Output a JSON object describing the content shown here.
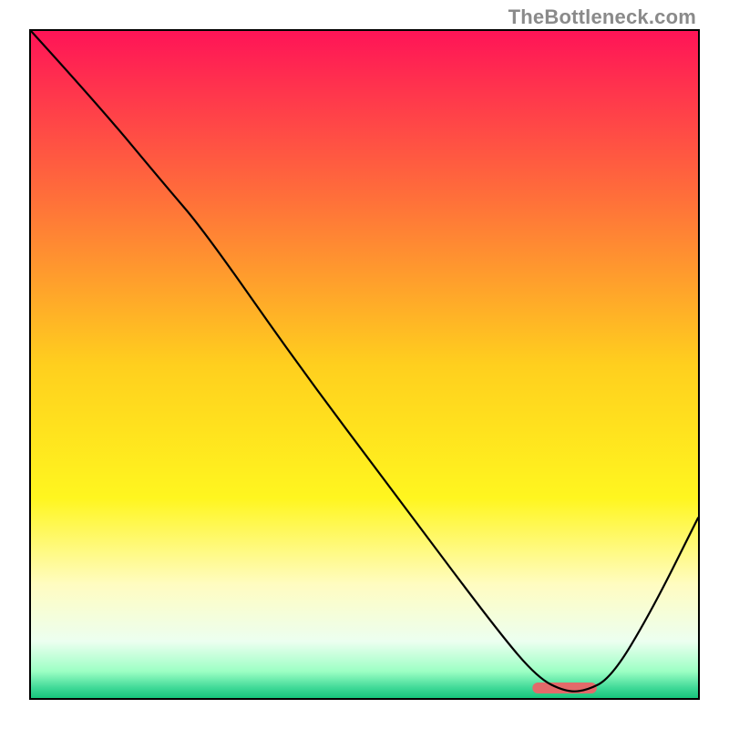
{
  "watermark_text": "TheBottleneck.com",
  "chart_data": {
    "type": "line",
    "title": "",
    "xlabel": "",
    "ylabel": "",
    "xlim": [
      0,
      100
    ],
    "ylim": [
      0,
      100
    ],
    "grid": false,
    "legend": false,
    "gradient_stops": [
      {
        "offset": 0.0,
        "color": "#ff1457"
      },
      {
        "offset": 0.25,
        "color": "#ff6f3a"
      },
      {
        "offset": 0.5,
        "color": "#ffcf1e"
      },
      {
        "offset": 0.7,
        "color": "#fff61f"
      },
      {
        "offset": 0.83,
        "color": "#fffcc1"
      },
      {
        "offset": 0.915,
        "color": "#ecfff0"
      },
      {
        "offset": 0.96,
        "color": "#9cffc4"
      },
      {
        "offset": 0.985,
        "color": "#3fd997"
      },
      {
        "offset": 1.0,
        "color": "#17c47b"
      }
    ],
    "series": [
      {
        "name": "bottleneck-curve",
        "type": "line",
        "stroke": "#000000",
        "stroke_width": 2.2,
        "x": [
          0,
          10,
          20,
          26,
          40,
          55,
          70,
          76,
          80,
          83,
          87,
          93,
          100
        ],
        "y": [
          100,
          89,
          77,
          70,
          50,
          30,
          10,
          3,
          1,
          1,
          3,
          13,
          27
        ]
      }
    ],
    "markers": [
      {
        "name": "trough-marker",
        "kind": "rounded-segment",
        "x_start": 76,
        "x_end": 84,
        "y": 1.5,
        "color": "#e36a6a",
        "thickness": 12
      }
    ]
  }
}
